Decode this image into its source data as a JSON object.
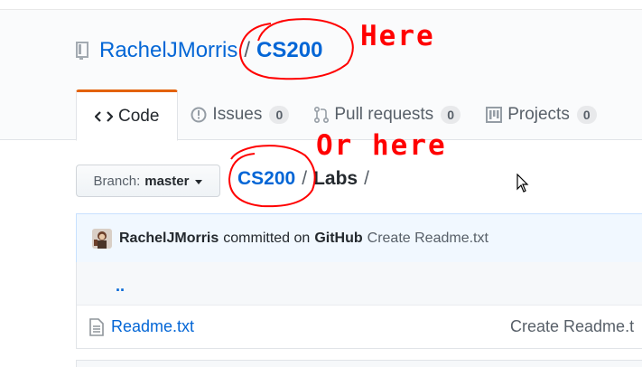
{
  "repo": {
    "owner": "RachelJMorris",
    "separator": "/",
    "name": "CS200"
  },
  "tabs": [
    {
      "label": "Code",
      "icon": "code-icon",
      "selected": true
    },
    {
      "label": "Issues",
      "icon": "issue-icon",
      "count": "0"
    },
    {
      "label": "Pull requests",
      "icon": "pull-request-icon",
      "count": "0"
    },
    {
      "label": "Projects",
      "icon": "project-icon",
      "count": "0"
    }
  ],
  "branch": {
    "prefix": "Branch:",
    "name": "master"
  },
  "breadcrumb": {
    "root": "CS200",
    "sep1": "/",
    "current": "Labs",
    "sep2": "/"
  },
  "commit": {
    "author": "RachelJMorris",
    "text": "committed on",
    "by": "GitHub",
    "message": "Create Readme.txt"
  },
  "files": {
    "up": "..",
    "items": [
      {
        "name": "Readme.txt",
        "message": "Create Readme.t"
      }
    ]
  },
  "annotations": {
    "first": "Here",
    "second": "Or here",
    "color": "#ff0000"
  },
  "colors": {
    "link": "#0366d6",
    "accent": "#e36209"
  }
}
